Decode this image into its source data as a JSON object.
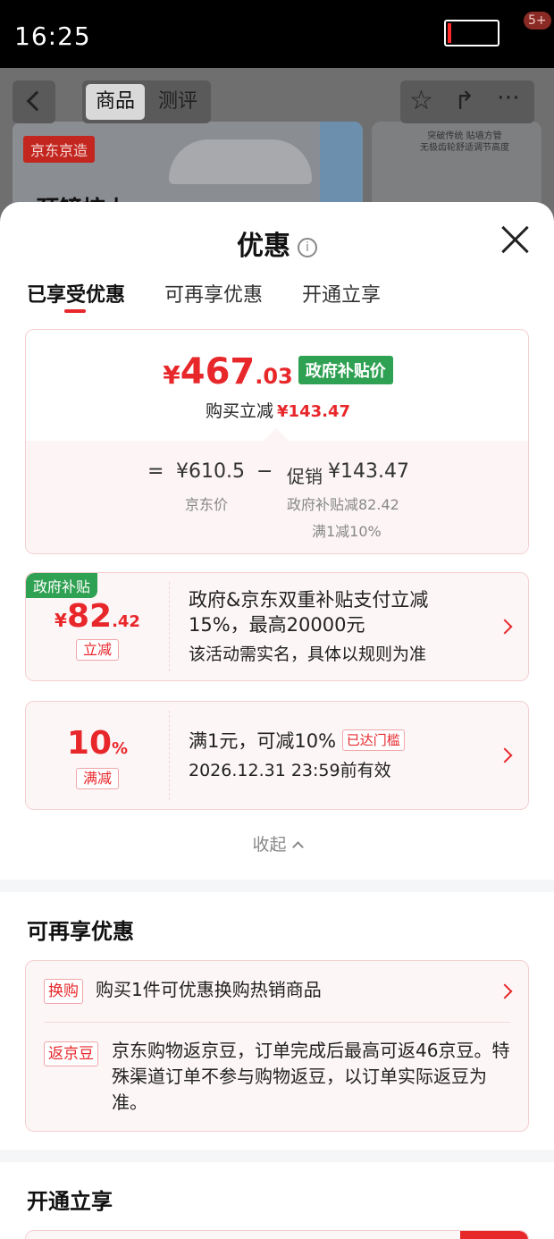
{
  "status": {
    "time": "16:25",
    "battery_percent": 8
  },
  "product_page": {
    "tab_product": "商品",
    "tab_review": "测评",
    "brand_tag": "京东京造",
    "image_caption": "突破传统 贴墙方管\n无极齿轮舒适调节高度",
    "partial_headline": "颈镜按上",
    "notification_badge": "5+"
  },
  "sheet": {
    "title": "优惠",
    "tabs": [
      "已享受优惠",
      "可再享优惠",
      "开通立享"
    ],
    "summary": {
      "currency": "¥",
      "price_int": "467",
      "price_dec": ".03",
      "price_tag": "政府补贴价",
      "reduce_label": "购买立减",
      "reduce_amount": "¥143.47",
      "equals": "=",
      "minus": "−",
      "jd_price": "¥610.5",
      "jd_price_label": "京东价",
      "promo_label": "促销",
      "promo_amount": "¥143.47",
      "promo_sub1": "政府补贴减82.42",
      "promo_sub2": "满1减10%"
    },
    "coupons": [
      {
        "tag": "政府补贴",
        "currency": "¥",
        "value_int": "82",
        "value_dec": ".42",
        "kind": "立减",
        "desc": "政府&京东双重补贴支付立减15%，最高20000元",
        "desc2": "该活动需实名，具体以规则为准"
      },
      {
        "value_int": "10",
        "value_dec": "%",
        "kind": "满减",
        "desc": "满1元，可减10%",
        "reached": "已达门槛",
        "desc2": "2026.12.31 23:59前有效"
      }
    ],
    "collapse_label": "收起",
    "more_section": {
      "title": "可再享优惠",
      "rows": [
        {
          "tag": "换购",
          "text": "购买1件可优惠换购热销商品"
        },
        {
          "tag": "返京豆",
          "text": "京东购物返京豆，订单完成后最高可返46京豆。特殊渠道订单不参与购物返豆，以订单实际返豆为准。"
        }
      ]
    },
    "open_section": {
      "title": "开通立享"
    }
  },
  "colors": {
    "accent": "#e8272b",
    "gov_green": "#2fa152"
  }
}
